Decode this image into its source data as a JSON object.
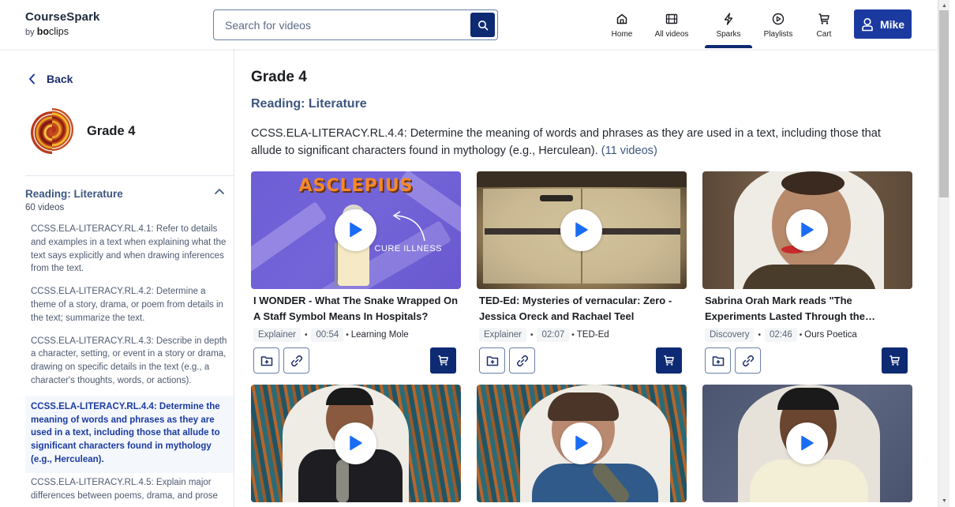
{
  "header": {
    "logo_title": "CourseSpark",
    "logo_by": "by",
    "logo_brand_bold": "bo",
    "logo_brand_light": "clips",
    "search_placeholder": "Search for videos",
    "search_value": "",
    "nav": [
      {
        "label": "Home",
        "icon": "home-icon",
        "active": false
      },
      {
        "label": "All videos",
        "icon": "film-icon",
        "active": false
      },
      {
        "label": "Sparks",
        "icon": "lightning-icon",
        "active": true
      },
      {
        "label": "Playlists",
        "icon": "play-circle-icon",
        "active": false
      },
      {
        "label": "Cart",
        "icon": "cart-icon",
        "active": false
      }
    ],
    "user_name": "Mike"
  },
  "sidebar": {
    "back_label": "Back",
    "grade_title": "Grade 4",
    "section": {
      "title": "Reading: Literature",
      "count": "60 videos",
      "expanded": true
    },
    "standards": [
      {
        "text": "CCSS.ELA-LITERACY.RL.4.1: Refer to details and examples in a text when explaining what the text says explicitly and when drawing inferences from the text.",
        "active": false
      },
      {
        "text": "CCSS.ELA-LITERACY.RL.4.2: Determine a theme of a story, drama, or poem from details in the text; summarize the text.",
        "active": false
      },
      {
        "text": "CCSS.ELA-LITERACY.RL.4.3: Describe in depth a character, setting, or event in a story or drama, drawing on specific details in the text (e.g., a character's thoughts, words, or actions).",
        "active": false
      },
      {
        "text": "CCSS.ELA-LITERACY.RL.4.4: Determine the meaning of words and phrases as they are used in a text, including those that allude to significant characters found in mythology (e.g., Herculean).",
        "active": true
      },
      {
        "text": "CCSS.ELA-LITERACY.RL.4.5: Explain major differences between poems, drama, and prose",
        "active": false
      }
    ]
  },
  "main": {
    "title": "Grade 4",
    "subtitle": "Reading: Literature",
    "description": "CCSS.ELA-LITERACY.RL.4.4: Determine the meaning of words and phrases as they are used in a text, including those that allude to significant characters found in mythology (e.g., Herculean).",
    "video_count": "(11 videos)",
    "videos": [
      {
        "title": "I WONDER - What The Snake Wrapped On A Staff Symbol Means In Hospitals?",
        "type": "Explainer",
        "duration": "00:54",
        "channel": "Learning Mole",
        "thumb_text": "ASCLEPIUS",
        "thumb_note": "CURE ILLNESS"
      },
      {
        "title": "TED-Ed: Mysteries of vernacular: Zero - Jessica Oreck and Rachael Teel",
        "type": "Explainer",
        "duration": "02:07",
        "channel": "TED-Ed"
      },
      {
        "title": "Sabrina Orah Mark reads \"The Experiments Lasted Through the…",
        "type": "Discovery",
        "duration": "02:46",
        "channel": "Ours Poetica"
      },
      {
        "title": "",
        "type": "",
        "duration": "",
        "channel": ""
      },
      {
        "title": "",
        "type": "",
        "duration": "",
        "channel": ""
      },
      {
        "title": "",
        "type": "",
        "duration": "",
        "channel": ""
      }
    ]
  },
  "colors": {
    "brand_navy": "#0e2a73",
    "brand_blue": "#1b3aa0",
    "heading_slate": "#3d5680",
    "play_blue": "#1a6cf5"
  }
}
